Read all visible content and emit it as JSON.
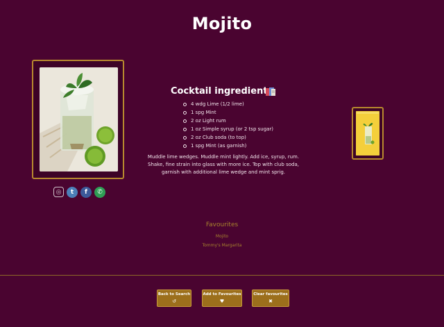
{
  "page": {
    "title": "Mojito"
  },
  "photo": {
    "alt_icon": "mojito-photo"
  },
  "socials": [
    {
      "name": "instagram-icon",
      "glyph": "◎"
    },
    {
      "name": "twitter-icon",
      "glyph": "t"
    },
    {
      "name": "facebook-icon",
      "glyph": "f"
    },
    {
      "name": "whatsapp-icon",
      "glyph": "✆"
    }
  ],
  "ingredients": {
    "heading": "Cocktail ingredients",
    "items": [
      "4 wdg Lime (1/2 lime)",
      "1 spg Mint",
      "2 oz Light rum",
      "1 oz Simple syrup (or 2 tsp sugar)",
      "2 oz Club soda (to top)",
      "1 spg Mint (as garnish)"
    ],
    "instructions": "Muddle lime wedges. Muddle mint lightly. Add ice, syrup, rum. Shake, fine strain into glass with more ice. Top with club soda, garnish with additional lime wedge and mint sprig."
  },
  "favourites": {
    "title": "Favourites",
    "items": [
      "Mojito",
      "Tommy's Margarita"
    ]
  },
  "buttons": {
    "back": {
      "label": "Back to Search",
      "icon": "↺"
    },
    "add": {
      "label": "Add to Favourites",
      "icon": "♥"
    },
    "clear": {
      "label": "Clear favourites",
      "icon": "✖"
    }
  },
  "colors": {
    "background": "#4a0430",
    "accent_gold": "#b88a2e",
    "button": "#9c6f1c"
  }
}
